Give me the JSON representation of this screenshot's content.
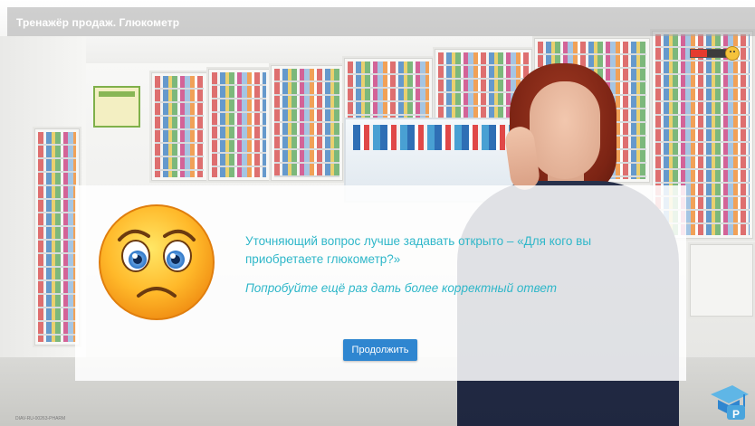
{
  "header": {
    "title": "Тренажёр продаж. Глюкометр"
  },
  "feedback": {
    "message": "Уточняющий вопрос лучше задавать открыто – «Для кого вы приобретаете глюкометр?»",
    "hint": "Попробуйте ещё раз дать более корректный ответ",
    "continue_label": "Продолжить",
    "text_color": "#2fb7c9",
    "button_color": "#2f86d0"
  },
  "mood_meter": {
    "level": 0.45,
    "icon": "sad-face-icon"
  },
  "icons": {
    "feedback": "sad-face-emoji-icon",
    "logo": "graduation-cap-logo-icon"
  },
  "footer": {
    "code": "DIAV-RU-00263-PHARM"
  }
}
